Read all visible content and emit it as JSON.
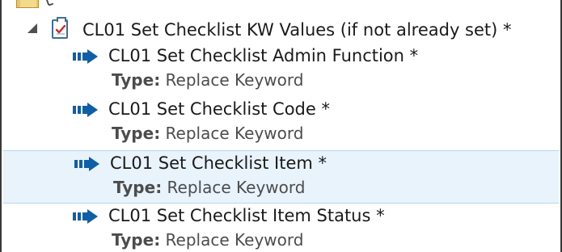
{
  "tree": {
    "parent": {
      "label": "CL01 Set Checklist KW Values (if not already set) *",
      "expanded": true,
      "icon": "checklist-clipboard-icon"
    },
    "children": [
      {
        "label": "CL01 Set Checklist Admin Function *",
        "type_label": "Type:",
        "type_value": "Replace Keyword",
        "icon": "action-arrow-icon"
      },
      {
        "label": "CL01 Set Checklist Code *",
        "type_label": "Type:",
        "type_value": "Replace Keyword",
        "icon": "action-arrow-icon"
      },
      {
        "label": "CL01 Set Checklist Item *",
        "type_label": "Type:",
        "type_value": "Replace Keyword",
        "icon": "action-arrow-icon",
        "selected": true
      },
      {
        "label": "CL01 Set Checklist Item Status *",
        "type_label": "Type:",
        "type_value": "Replace Keyword",
        "icon": "action-arrow-icon"
      }
    ]
  },
  "colors": {
    "selection_background": "#e8f3fc",
    "selection_border": "#b7d7f1",
    "icon_blue": "#0f5ea8",
    "text": "#1a1a1a",
    "secondary_text": "#4c4c4c"
  }
}
